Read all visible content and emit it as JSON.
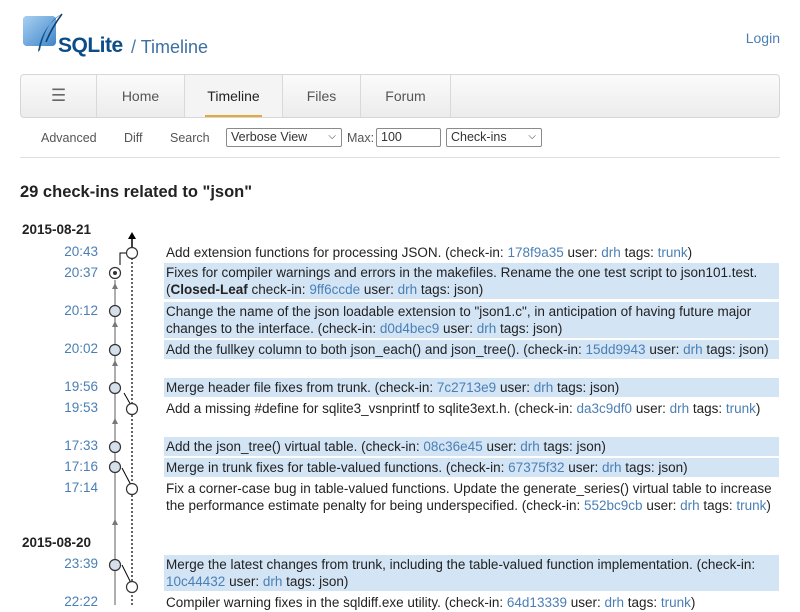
{
  "header": {
    "logo_text": "SQLite",
    "page_title": "Timeline",
    "login": "Login"
  },
  "mainmenu": {
    "hamburger": "☰",
    "items": [
      "Home",
      "Timeline",
      "Files",
      "Forum"
    ],
    "active": "Timeline"
  },
  "submenu": {
    "advanced": "Advanced",
    "diff": "Diff",
    "search": "Search",
    "view_select": "Verbose View",
    "max_label": "Max:",
    "max_value": "100",
    "type_select": "Check-ins"
  },
  "title": "29 check-ins related to \"json\"",
  "colors": {
    "link": "#4a7fb5",
    "highlight": "#d3e4f5"
  },
  "dates": [
    "2015-08-21",
    "2015-08-20"
  ],
  "entries": [
    {
      "time": "20:43",
      "text": "Add extension functions for processing JSON.",
      "hash": "178f9a35",
      "user": "drh",
      "tags": "trunk",
      "closed": false,
      "hl": false
    },
    {
      "time": "20:37",
      "text": "Fixes for compiler warnings and errors in the makefiles. Rename the one test script to json101.test.",
      "hash": "9ff6ccde",
      "user": "drh",
      "tags": "json",
      "closed": true,
      "closed_label": "Closed-Leaf",
      "hl": true
    },
    {
      "time": "20:12",
      "text": "Change the name of the json loadable extension to \"json1.c\", in anticipation of having future major changes to the interface.",
      "hash": "d0d4bec9",
      "user": "drh",
      "tags": "json",
      "closed": false,
      "hl": true
    },
    {
      "time": "20:02",
      "text": "Add the fullkey column to both json_each() and json_tree().",
      "hash": "15dd9943",
      "user": "drh",
      "tags": "json",
      "closed": false,
      "hl": true
    },
    {
      "time": "19:56",
      "text": "Merge header file fixes from trunk.",
      "hash": "7c2713e9",
      "user": "drh",
      "tags": "json",
      "closed": false,
      "hl": true
    },
    {
      "time": "19:53",
      "text": "Add a missing #define for sqlite3_vsnprintf to sqlite3ext.h.",
      "hash": "da3c9df0",
      "user": "drh",
      "tags": "trunk",
      "closed": false,
      "hl": false
    },
    {
      "time": "17:33",
      "text": "Add the json_tree() virtual table.",
      "hash": "08c36e45",
      "user": "drh",
      "tags": "json",
      "closed": false,
      "hl": true
    },
    {
      "time": "17:16",
      "text": "Merge in trunk fixes for table-valued functions.",
      "hash": "67375f32",
      "user": "drh",
      "tags": "json",
      "closed": false,
      "hl": true
    },
    {
      "time": "17:14",
      "text": "Fix a corner-case bug in table-valued functions. Update the generate_series() virtual table to increase the performance estimate penalty for being underspecified.",
      "hash": "552bc9cb",
      "user": "drh",
      "tags": "trunk",
      "closed": false,
      "hl": false
    },
    {
      "time": "23:39",
      "text": "Merge the latest changes from trunk, including the table-valued function implementation.",
      "hash": "10c44432",
      "user": "drh",
      "tags": "json",
      "closed": false,
      "hl": true
    },
    {
      "time": "22:22",
      "text": "Compiler warning fixes in the sqldiff.exe utility.",
      "hash": "64d13339",
      "user": "drh",
      "tags": "trunk",
      "closed": false,
      "hl": false
    }
  ],
  "labels": {
    "checkin": "check-in:",
    "user": "user:",
    "tags": "tags:"
  }
}
